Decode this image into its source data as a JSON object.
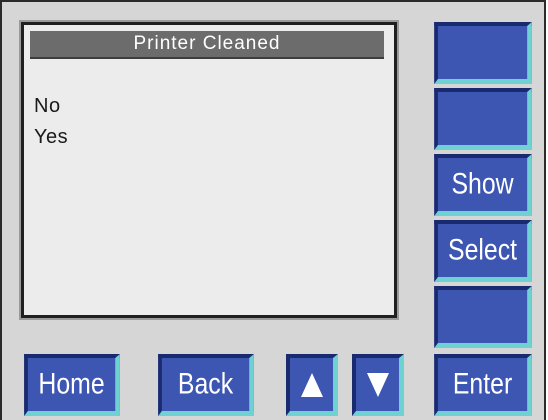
{
  "screen": {
    "title": "Printer Cleaned",
    "options": [
      "No",
      "Yes"
    ]
  },
  "side_buttons": [
    "",
    "",
    "Show",
    "Select",
    ""
  ],
  "bottom_buttons": {
    "home": "Home",
    "back": "Back",
    "up_icon": "arrow-up-icon",
    "down_icon": "arrow-down-icon",
    "enter": "Enter"
  },
  "colors": {
    "panel": "#d6d6d6",
    "screen": "#ececec",
    "title_bar": "#6c6c6c",
    "button": "#3c56b2",
    "button_highlight": "#6fd2d2",
    "button_shadow": "#1a2a6e"
  }
}
